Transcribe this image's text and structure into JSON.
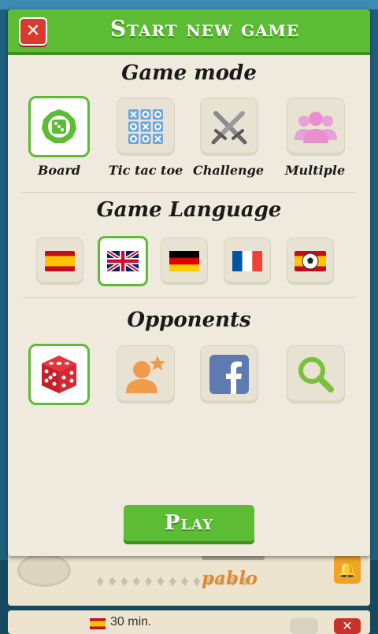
{
  "dialog": {
    "title": "Start new game",
    "close_label": "✕",
    "play_label": "Play"
  },
  "game_mode": {
    "heading": "Game mode",
    "options": [
      {
        "label": "Board",
        "icon": "board-gear-icon",
        "selected": true
      },
      {
        "label": "Tic tac toe",
        "icon": "tic-tac-toe-icon",
        "selected": false
      },
      {
        "label": "Challenge",
        "icon": "crossed-swords-icon",
        "selected": false
      },
      {
        "label": "Multiple",
        "icon": "people-group-icon",
        "selected": false
      }
    ]
  },
  "game_language": {
    "heading": "Game Language",
    "options": [
      {
        "icon": "spain-flag-icon",
        "selected": false
      },
      {
        "icon": "uk-flag-icon",
        "selected": true
      },
      {
        "icon": "germany-flag-icon",
        "selected": false
      },
      {
        "icon": "france-flag-icon",
        "selected": false
      },
      {
        "icon": "spain-football-flag-icon",
        "selected": false
      }
    ]
  },
  "opponents": {
    "heading": "Opponents",
    "options": [
      {
        "icon": "dice-icon",
        "selected": true
      },
      {
        "icon": "friend-star-icon",
        "selected": false
      },
      {
        "icon": "facebook-icon",
        "selected": false
      },
      {
        "icon": "search-icon",
        "selected": false
      }
    ]
  },
  "background": {
    "player_name": "pablo",
    "time_label": "30 min."
  },
  "colors": {
    "accent_green": "#5cbd34",
    "close_red": "#d93a2e",
    "panel_bg": "#efeadd"
  }
}
